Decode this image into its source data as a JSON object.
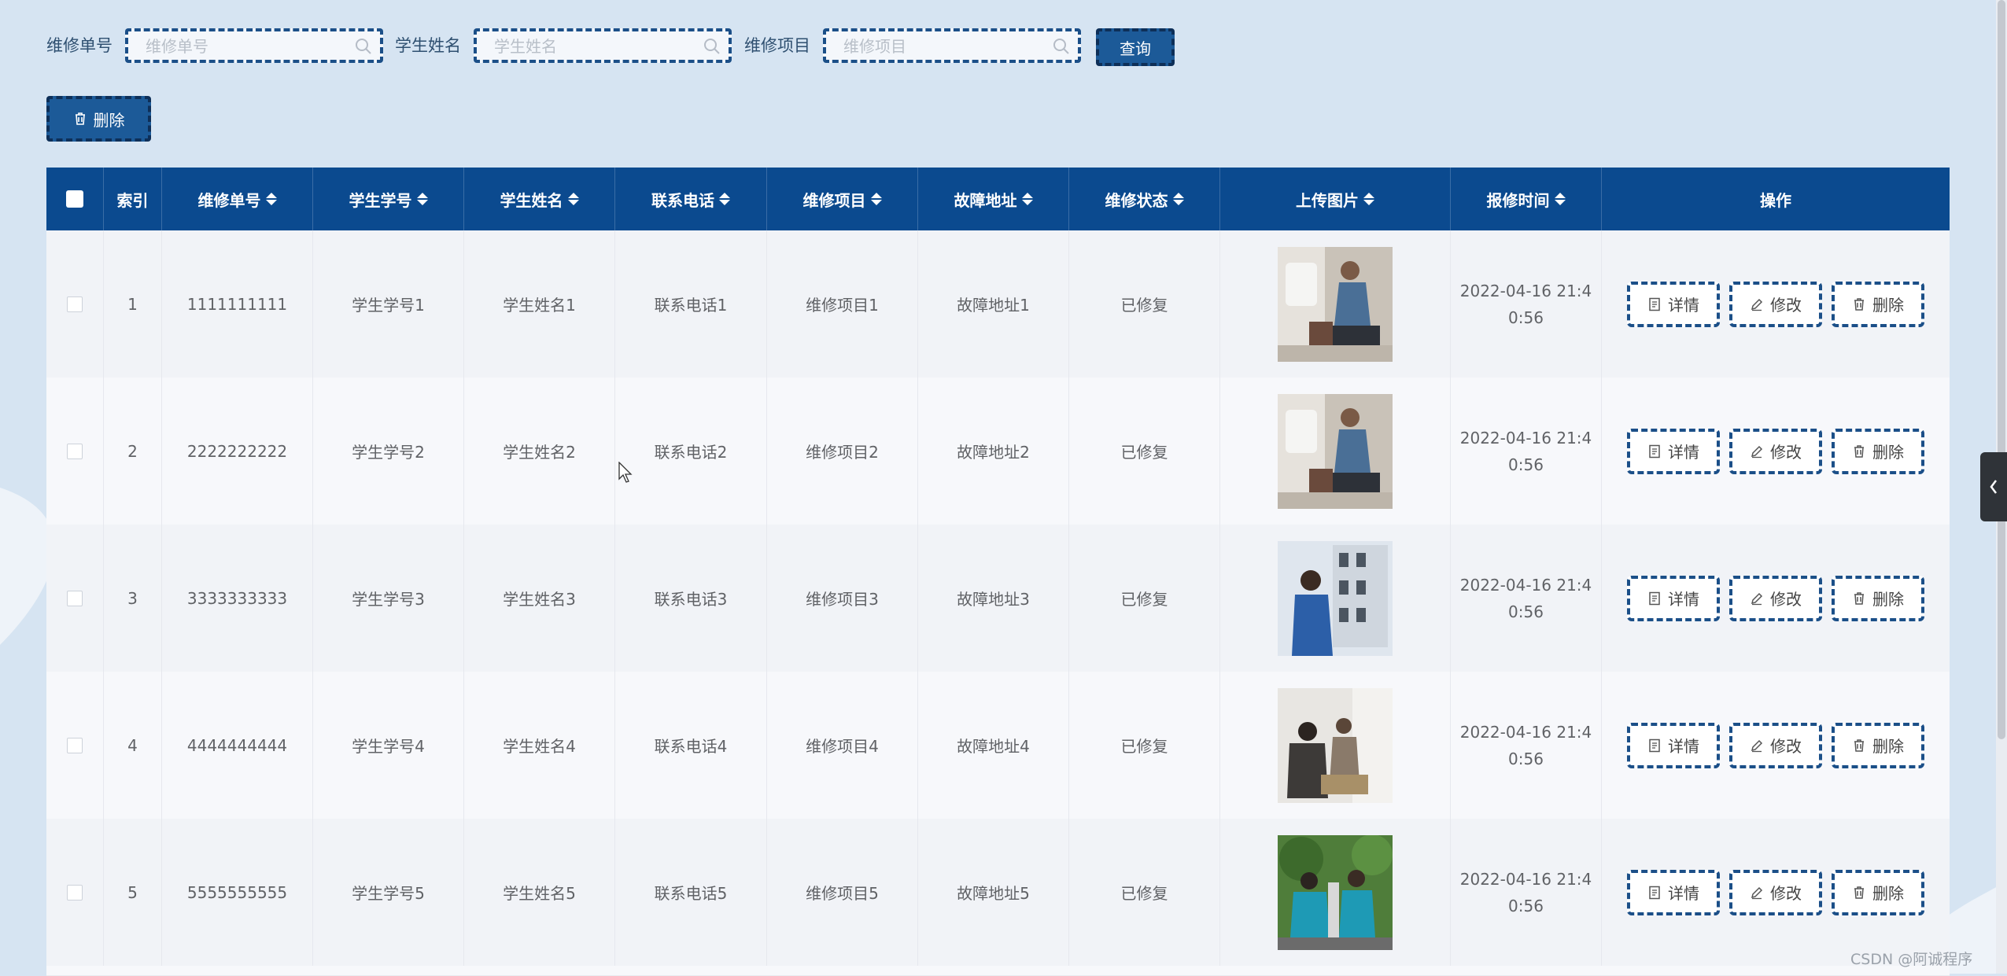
{
  "search": {
    "fields": [
      {
        "label": "维修单号",
        "placeholder": "维修单号"
      },
      {
        "label": "学生姓名",
        "placeholder": "学生姓名"
      },
      {
        "label": "维修项目",
        "placeholder": "维修项目"
      }
    ],
    "query_label": "查询"
  },
  "toolbar": {
    "delete_label": "删除"
  },
  "table": {
    "headers": [
      "索引",
      "维修单号",
      "学生学号",
      "学生姓名",
      "联系电话",
      "维修项目",
      "故障地址",
      "维修状态",
      "上传图片",
      "报修时间",
      "操作"
    ],
    "rows": [
      {
        "index": "1",
        "order_no": "1111111111",
        "student_id": "学生学号1",
        "student_name": "学生姓名1",
        "phone": "联系电话1",
        "project": "维修项目1",
        "address": "故障地址1",
        "status": "已修复",
        "time_line1": "2022-04-16 21:4",
        "time_line2": "0:56"
      },
      {
        "index": "2",
        "order_no": "2222222222",
        "student_id": "学生学号2",
        "student_name": "学生姓名2",
        "phone": "联系电话2",
        "project": "维修项目2",
        "address": "故障地址2",
        "status": "已修复",
        "time_line1": "2022-04-16 21:4",
        "time_line2": "0:56"
      },
      {
        "index": "3",
        "order_no": "3333333333",
        "student_id": "学生学号3",
        "student_name": "学生姓名3",
        "phone": "联系电话3",
        "project": "维修项目3",
        "address": "故障地址3",
        "status": "已修复",
        "time_line1": "2022-04-16 21:4",
        "time_line2": "0:56"
      },
      {
        "index": "4",
        "order_no": "4444444444",
        "student_id": "学生学号4",
        "student_name": "学生姓名4",
        "phone": "联系电话4",
        "project": "维修项目4",
        "address": "故障地址4",
        "status": "已修复",
        "time_line1": "2022-04-16 21:4",
        "time_line2": "0:56"
      },
      {
        "index": "5",
        "order_no": "5555555555",
        "student_id": "学生学号5",
        "student_name": "学生姓名5",
        "phone": "联系电话5",
        "project": "维修项目5",
        "address": "故障地址5",
        "status": "已修复",
        "time_line1": "2022-04-16 21:4",
        "time_line2": "0:56"
      }
    ],
    "actions": {
      "detail": "详情",
      "edit": "修改",
      "delete": "删除"
    }
  },
  "watermark": "CSDN @阿诚程序",
  "colors": {
    "header_bg": "#0b4a8f",
    "accent": "#1c5a98",
    "page_bg": "#d6e4f2"
  }
}
